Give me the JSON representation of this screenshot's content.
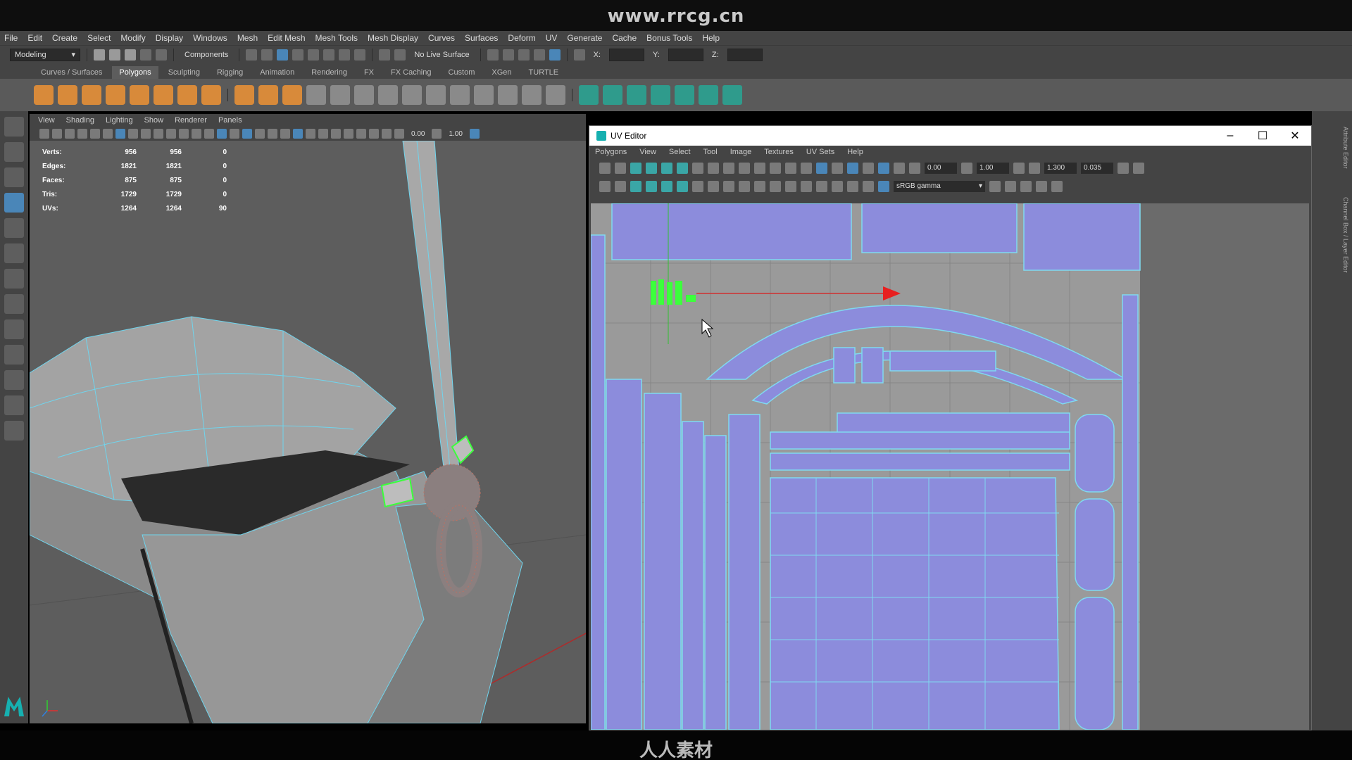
{
  "banner": {
    "watermark_url": "www.rrcg.cn"
  },
  "menubar": {
    "items": [
      "File",
      "Edit",
      "Create",
      "Select",
      "Modify",
      "Display",
      "Windows",
      "Mesh",
      "Edit Mesh",
      "Mesh Tools",
      "Mesh Display",
      "Curves",
      "Surfaces",
      "Deform",
      "UV",
      "Generate",
      "Cache",
      "Bonus Tools",
      "Help"
    ]
  },
  "statusline": {
    "mode": "Modeling",
    "select_mode": "Components",
    "live_surface": "No Live Surface",
    "x_label": "X:",
    "y_label": "Y:",
    "z_label": "Z:"
  },
  "shelf": {
    "tabs": [
      "Curves / Surfaces",
      "Polygons",
      "Sculpting",
      "Rigging",
      "Animation",
      "Rendering",
      "FX",
      "FX Caching",
      "Custom",
      "XGen",
      "TURTLE"
    ],
    "active_tab": "Polygons"
  },
  "viewport": {
    "menu": [
      "View",
      "Shading",
      "Lighting",
      "Show",
      "Renderer",
      "Panels"
    ],
    "exposure": "0.00",
    "gamma": "1.00",
    "hud": [
      {
        "label": "Verts:",
        "a": "956",
        "b": "956",
        "c": "0"
      },
      {
        "label": "Edges:",
        "a": "1821",
        "b": "1821",
        "c": "0"
      },
      {
        "label": "Faces:",
        "a": "875",
        "b": "875",
        "c": "0"
      },
      {
        "label": "Tris:",
        "a": "1729",
        "b": "1729",
        "c": "0"
      },
      {
        "label": "UVs:",
        "a": "1264",
        "b": "1264",
        "c": "90"
      }
    ]
  },
  "uv_editor": {
    "title": "UV Editor",
    "menu": [
      "Polygons",
      "View",
      "Select",
      "Tool",
      "Image",
      "Textures",
      "UV Sets",
      "Help"
    ],
    "exposure": "0.00",
    "gamma": "1.00",
    "color_space": "sRGB gamma",
    "field_a": "1.300",
    "field_b": "0.035"
  },
  "dock": {
    "attribute_editor": "Attribute Editor",
    "channel_box": "Channel Box / Layer Editor"
  },
  "bottom": {
    "watermark": "人人素材"
  },
  "colors": {
    "uv_shell": "#8c8cdc",
    "uv_edge": "#7fd9f0",
    "selected": "#3cff3c",
    "arrow": "#e82020",
    "maya_teal": "#16b0b0"
  }
}
